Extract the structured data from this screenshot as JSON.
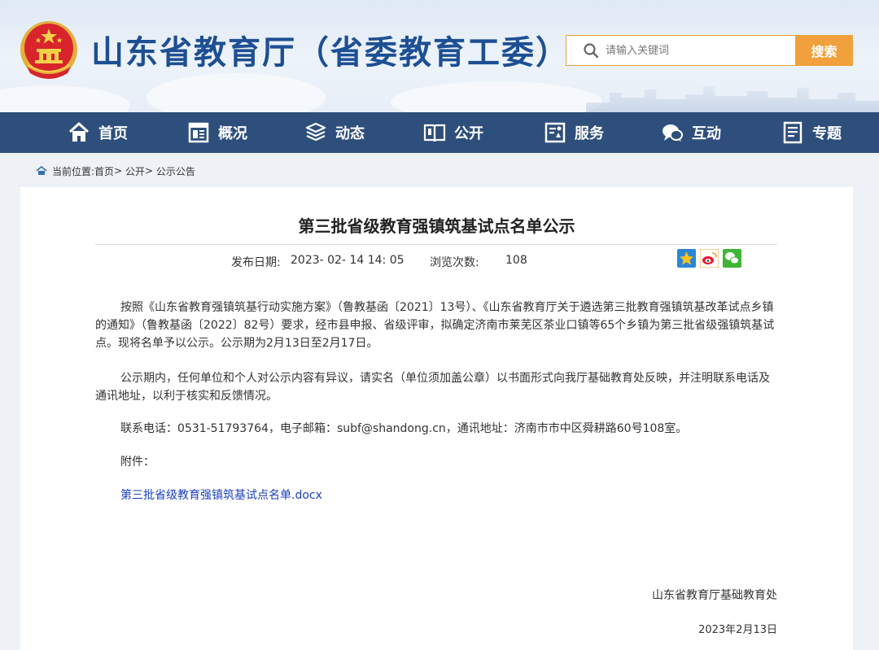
{
  "header": {
    "site_title": "山东省教育厅（省委教育工委）",
    "search_placeholder": "请输入关键词",
    "search_button": "搜索"
  },
  "nav": {
    "items": [
      {
        "label": "首页",
        "icon": "home-icon"
      },
      {
        "label": "概况",
        "icon": "overview-icon"
      },
      {
        "label": "动态",
        "icon": "news-icon"
      },
      {
        "label": "公开",
        "icon": "book-icon"
      },
      {
        "label": "服务",
        "icon": "service-icon"
      },
      {
        "label": "互动",
        "icon": "chat-icon"
      },
      {
        "label": "专题",
        "icon": "topic-icon"
      }
    ]
  },
  "breadcrumb": {
    "prefix": "当前位置:",
    "items": [
      "首页",
      "公开",
      "公示公告"
    ],
    "separator": ">"
  },
  "article": {
    "title": "第三批省级教育强镇筑基试点名单公示",
    "publish_label": "发布日期:",
    "publish_date": "2023- 02- 14 14: 05",
    "views_label": "浏览次数:",
    "views": "108",
    "paragraphs": [
      "按照《山东省教育强镇筑基行动实施方案》（鲁教基函〔2021〕13号）、《山东省教育厅关于遴选第三批教育强镇筑基改革试点乡镇的通知》（鲁教基函〔2022〕82号）要求，经市县申报、省级评审，拟确定济南市莱芜区茶业口镇等65个乡镇为第三批省级强镇筑基试点。现将名单予以公示。公示期为2月13日至2月17日。",
      "公示期内，任何单位和个人对公示内容有异议，请实名（单位须加盖公章）以书面形式向我厅基础教育处反映，并注明联系电话及通讯地址，以利于核实和反馈情况。",
      "联系电话：0531-51793764，电子邮箱：subf@shandong.cn，通讯地址：济南市市中区舜耕路60号108室。",
      "附件："
    ],
    "attachment": "第三批省级教育强镇筑基试点名单.docx",
    "signer": "山东省教育厅基础教育处",
    "sign_date": "2023年2月13日"
  },
  "colors": {
    "title_blue": "#1d4f93",
    "nav_bg": "#2e4f7c",
    "search_orange": "#f0a13b",
    "link_blue": "#1a3fc0"
  }
}
